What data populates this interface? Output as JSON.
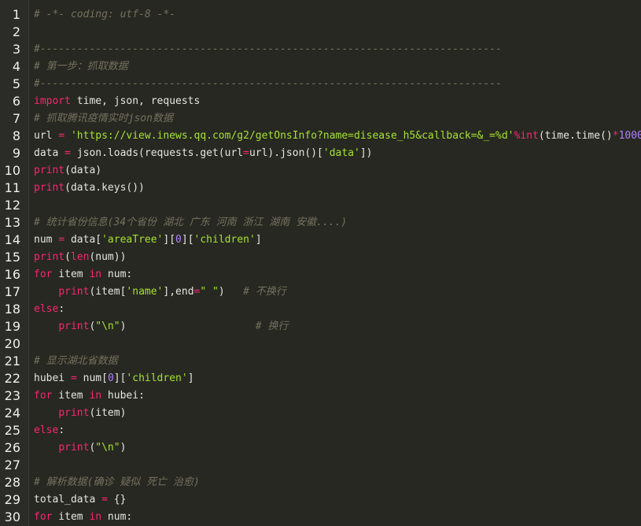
{
  "editor": {
    "lines": [
      {
        "n": "1",
        "tokens": [
          {
            "c": "cmt",
            "t": "# -*- coding: utf-8 -*-"
          }
        ]
      },
      {
        "n": "2",
        "tokens": []
      },
      {
        "n": "3",
        "tokens": [
          {
            "c": "cmt",
            "t": "#---------------------------------------------------------------------------"
          }
        ]
      },
      {
        "n": "4",
        "tokens": [
          {
            "c": "cmt",
            "t": "# 第一步：抓取数据"
          }
        ]
      },
      {
        "n": "5",
        "tokens": [
          {
            "c": "cmt",
            "t": "#---------------------------------------------------------------------------"
          }
        ]
      },
      {
        "n": "6",
        "tokens": [
          {
            "c": "kw",
            "t": "import"
          },
          {
            "c": "id",
            "t": " time, json, requests"
          }
        ]
      },
      {
        "n": "7",
        "tokens": [
          {
            "c": "cmt",
            "t": "# 抓取腾讯疫情实时json数据"
          }
        ]
      },
      {
        "n": "8",
        "tokens": [
          {
            "c": "id",
            "t": "url "
          },
          {
            "c": "op",
            "t": "="
          },
          {
            "c": "id",
            "t": " "
          },
          {
            "c": "str",
            "t": "'https://view.inews.qq.com/g2/getOnsInfo?name=disease_h5&callback=&_=%d'"
          },
          {
            "c": "op",
            "t": "%"
          },
          {
            "c": "bi",
            "t": "int"
          },
          {
            "c": "id",
            "t": "(time.time()"
          },
          {
            "c": "op",
            "t": "*"
          },
          {
            "c": "num",
            "t": "1000"
          },
          {
            "c": "id",
            "t": ")"
          }
        ]
      },
      {
        "n": "9",
        "tokens": [
          {
            "c": "id",
            "t": "data "
          },
          {
            "c": "op",
            "t": "="
          },
          {
            "c": "id",
            "t": " json.loads(requests.get(url"
          },
          {
            "c": "op",
            "t": "="
          },
          {
            "c": "id",
            "t": "url).json()["
          },
          {
            "c": "str",
            "t": "'data'"
          },
          {
            "c": "id",
            "t": "])"
          }
        ]
      },
      {
        "n": "10",
        "tokens": [
          {
            "c": "bi",
            "t": "print"
          },
          {
            "c": "id",
            "t": "(data)"
          }
        ]
      },
      {
        "n": "11",
        "tokens": [
          {
            "c": "bi",
            "t": "print"
          },
          {
            "c": "id",
            "t": "(data.keys())"
          }
        ]
      },
      {
        "n": "12",
        "tokens": []
      },
      {
        "n": "13",
        "tokens": [
          {
            "c": "cmt",
            "t": "# 统计省份信息(34个省份 湖北 广东 河南 浙江 湖南 安徽....)"
          }
        ]
      },
      {
        "n": "14",
        "tokens": [
          {
            "c": "id",
            "t": "num "
          },
          {
            "c": "op",
            "t": "="
          },
          {
            "c": "id",
            "t": " data["
          },
          {
            "c": "str",
            "t": "'areaTree'"
          },
          {
            "c": "id",
            "t": "]["
          },
          {
            "c": "num",
            "t": "0"
          },
          {
            "c": "id",
            "t": "]["
          },
          {
            "c": "str",
            "t": "'children'"
          },
          {
            "c": "id",
            "t": "]"
          }
        ]
      },
      {
        "n": "15",
        "tokens": [
          {
            "c": "bi",
            "t": "print"
          },
          {
            "c": "id",
            "t": "("
          },
          {
            "c": "bi",
            "t": "len"
          },
          {
            "c": "id",
            "t": "(num))"
          }
        ]
      },
      {
        "n": "16",
        "tokens": [
          {
            "c": "kw",
            "t": "for"
          },
          {
            "c": "id",
            "t": " item "
          },
          {
            "c": "kw",
            "t": "in"
          },
          {
            "c": "id",
            "t": " num:"
          }
        ]
      },
      {
        "n": "17",
        "tokens": [
          {
            "c": "id",
            "t": "    "
          },
          {
            "c": "bi",
            "t": "print"
          },
          {
            "c": "id",
            "t": "(item["
          },
          {
            "c": "str",
            "t": "'name'"
          },
          {
            "c": "id",
            "t": "],end"
          },
          {
            "c": "op",
            "t": "="
          },
          {
            "c": "str",
            "t": "\" \""
          },
          {
            "c": "id",
            "t": ")   "
          },
          {
            "c": "cmt",
            "t": "# 不换行"
          }
        ]
      },
      {
        "n": "18",
        "tokens": [
          {
            "c": "kw",
            "t": "else"
          },
          {
            "c": "id",
            "t": ":"
          }
        ]
      },
      {
        "n": "19",
        "tokens": [
          {
            "c": "id",
            "t": "    "
          },
          {
            "c": "bi",
            "t": "print"
          },
          {
            "c": "id",
            "t": "("
          },
          {
            "c": "str",
            "t": "\"\\n\""
          },
          {
            "c": "id",
            "t": ")                     "
          },
          {
            "c": "cmt",
            "t": "# 换行"
          }
        ]
      },
      {
        "n": "20",
        "tokens": []
      },
      {
        "n": "21",
        "tokens": [
          {
            "c": "cmt",
            "t": "# 显示湖北省数据"
          }
        ]
      },
      {
        "n": "22",
        "tokens": [
          {
            "c": "id",
            "t": "hubei "
          },
          {
            "c": "op",
            "t": "="
          },
          {
            "c": "id",
            "t": " num["
          },
          {
            "c": "num",
            "t": "0"
          },
          {
            "c": "id",
            "t": "]["
          },
          {
            "c": "str",
            "t": "'children'"
          },
          {
            "c": "id",
            "t": "]"
          }
        ]
      },
      {
        "n": "23",
        "tokens": [
          {
            "c": "kw",
            "t": "for"
          },
          {
            "c": "id",
            "t": " item "
          },
          {
            "c": "kw",
            "t": "in"
          },
          {
            "c": "id",
            "t": " hubei:"
          }
        ]
      },
      {
        "n": "24",
        "tokens": [
          {
            "c": "id",
            "t": "    "
          },
          {
            "c": "bi",
            "t": "print"
          },
          {
            "c": "id",
            "t": "(item)"
          }
        ]
      },
      {
        "n": "25",
        "tokens": [
          {
            "c": "kw",
            "t": "else"
          },
          {
            "c": "id",
            "t": ":"
          }
        ]
      },
      {
        "n": "26",
        "tokens": [
          {
            "c": "id",
            "t": "    "
          },
          {
            "c": "bi",
            "t": "print"
          },
          {
            "c": "id",
            "t": "("
          },
          {
            "c": "str",
            "t": "\"\\n\""
          },
          {
            "c": "id",
            "t": ")"
          }
        ]
      },
      {
        "n": "27",
        "tokens": []
      },
      {
        "n": "28",
        "tokens": [
          {
            "c": "cmt",
            "t": "# 解析数据(确诊 疑似 死亡 治愈)"
          }
        ]
      },
      {
        "n": "29",
        "tokens": [
          {
            "c": "id",
            "t": "total_data "
          },
          {
            "c": "op",
            "t": "="
          },
          {
            "c": "id",
            "t": " {}"
          }
        ]
      },
      {
        "n": "30",
        "tokens": [
          {
            "c": "kw",
            "t": "for"
          },
          {
            "c": "id",
            "t": " item "
          },
          {
            "c": "kw",
            "t": "in"
          },
          {
            "c": "id",
            "t": " num:"
          }
        ]
      }
    ]
  },
  "colors": {
    "background": "#272822",
    "comment": "#75715e",
    "keyword": "#f92672",
    "string": "#a6e22e",
    "number": "#ae81ff",
    "text": "#e6e6e0"
  }
}
